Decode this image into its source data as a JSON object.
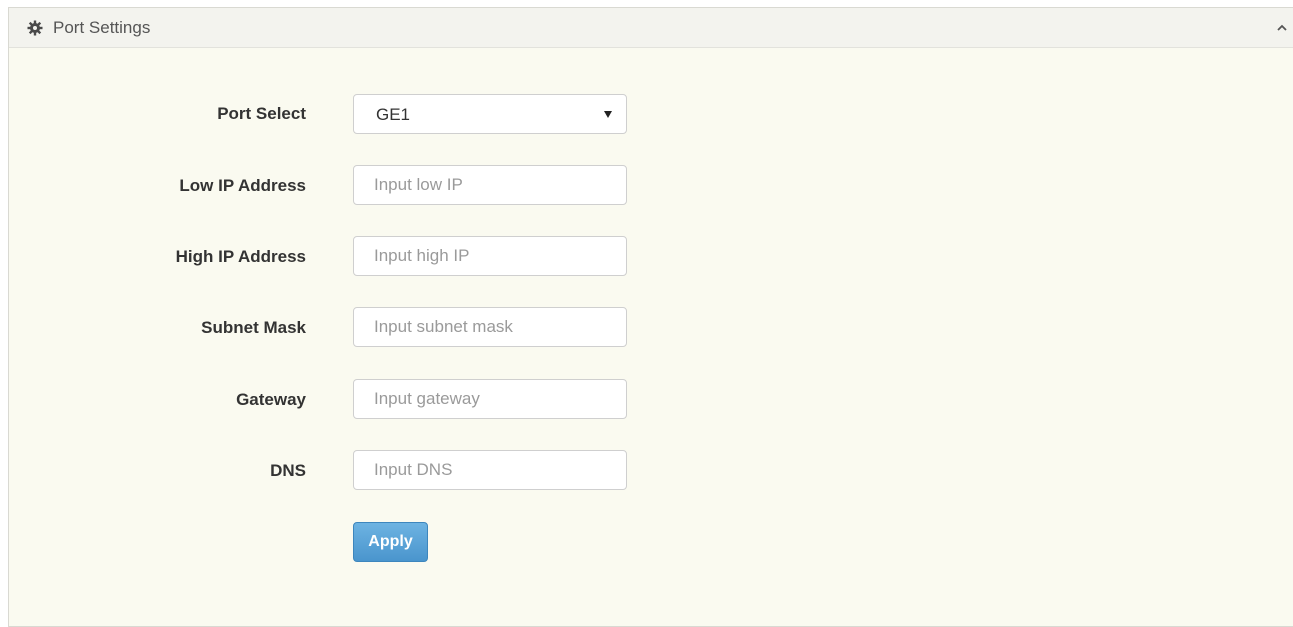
{
  "panel": {
    "title": "Port Settings",
    "icon": "gear-icon",
    "collapse_icon": "chevron-up-icon"
  },
  "form": {
    "port_select": {
      "label": "Port Select",
      "value": "GE1"
    },
    "low_ip": {
      "label": "Low IP Address",
      "value": "",
      "placeholder": "Input low IP"
    },
    "high_ip": {
      "label": "High IP Address",
      "value": "",
      "placeholder": "Input high IP"
    },
    "subnet_mask": {
      "label": "Subnet Mask",
      "value": "",
      "placeholder": "Input subnet mask"
    },
    "gateway": {
      "label": "Gateway",
      "value": "",
      "placeholder": "Input gateway"
    },
    "dns": {
      "label": "DNS",
      "value": "",
      "placeholder": "Input DNS"
    },
    "apply_label": "Apply"
  },
  "colors": {
    "apply_button": "#4a95cd",
    "panel_background": "#fafaf0"
  }
}
